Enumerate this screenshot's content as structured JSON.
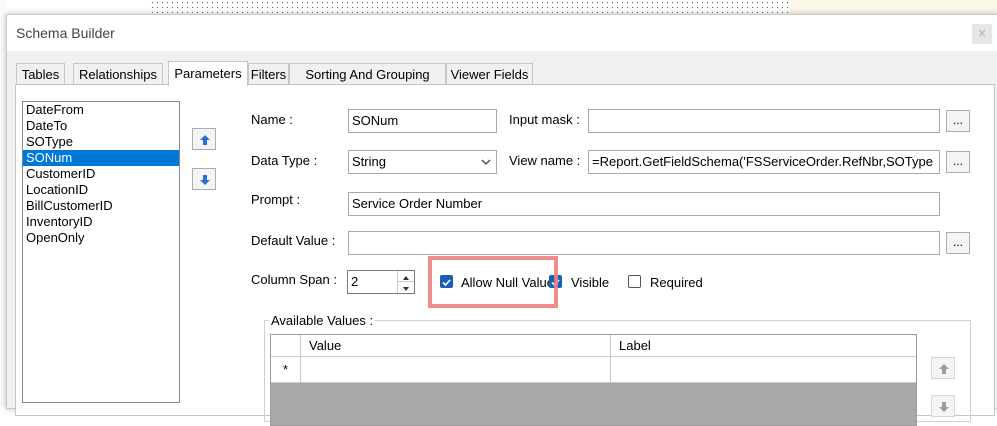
{
  "dialog": {
    "title": "Schema Builder",
    "close_glyph": "✕"
  },
  "tabs": [
    "Tables",
    "Relationships",
    "Parameters",
    "Filters",
    "Sorting And Grouping",
    "Viewer Fields"
  ],
  "active_tab": "Parameters",
  "parameters": [
    "DateFrom",
    "DateTo",
    "SOType",
    "SONum",
    "CustomerID",
    "LocationID",
    "BillCustomerID",
    "InventoryID",
    "OpenOnly"
  ],
  "selected_parameter": "SONum",
  "form": {
    "name_label": "Name :",
    "name_value": "SONum",
    "input_mask_label": "Input mask :",
    "input_mask_value": "",
    "data_type_label": "Data Type :",
    "data_type_value": "String",
    "view_name_label": "View name :",
    "view_name_value": "=Report.GetFieldSchema('FSServiceOrder.RefNbr,SOType",
    "prompt_label": "Prompt :",
    "prompt_value": "Service Order Number",
    "default_value_label": "Default Value :",
    "default_value_value": "",
    "column_span_label": "Column Span :",
    "column_span_value": "2",
    "allow_null_label": "Allow Null Value",
    "allow_null_checked": true,
    "visible_label": "Visible",
    "visible_checked": true,
    "required_label": "Required",
    "required_checked": false,
    "browse_label": "..."
  },
  "available_values": {
    "group_title": "Available Values :",
    "columns": [
      "Value",
      "Label"
    ],
    "new_row_marker": "*"
  },
  "colors": {
    "selection": "#0078d7",
    "checkbox_checked": "#1a5fb4",
    "highlight": "#f08080"
  }
}
